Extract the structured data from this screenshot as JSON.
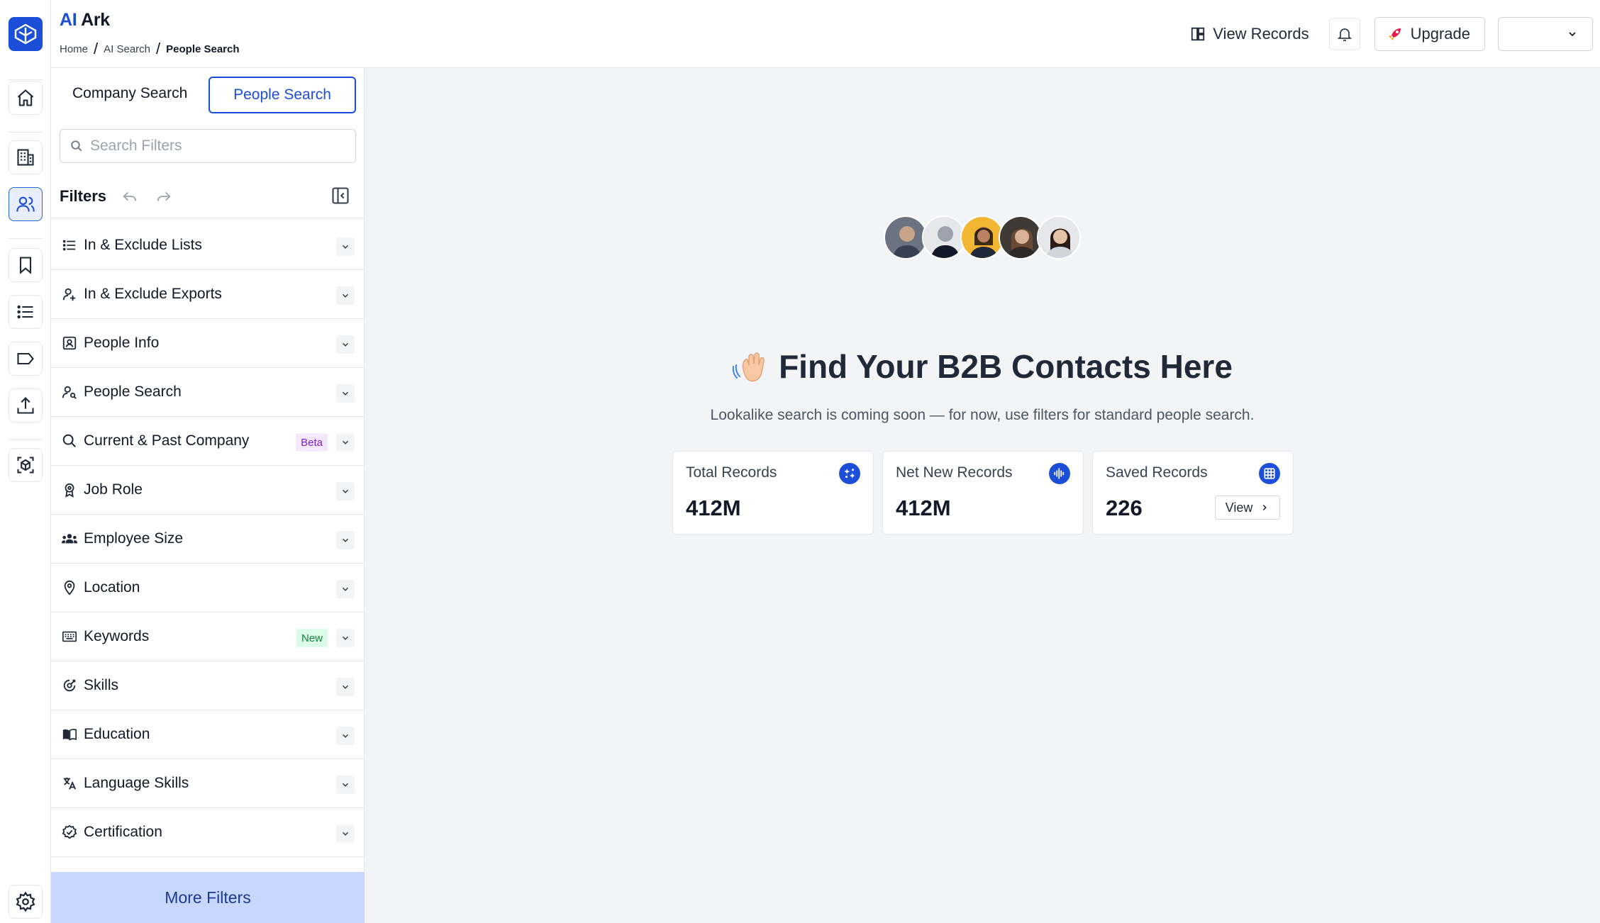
{
  "brand": {
    "ai": "AI",
    "ark": "Ark"
  },
  "breadcrumb": {
    "home": "Home",
    "ai_search": "AI Search",
    "current": "People Search"
  },
  "header": {
    "view_records": "View Records",
    "upgrade": "Upgrade"
  },
  "tabs": {
    "company": "Company Search",
    "people": "People Search"
  },
  "search": {
    "placeholder": "Search Filters"
  },
  "filters": {
    "title": "Filters",
    "items": [
      {
        "label": "In & Exclude Lists",
        "icon": "list-icon"
      },
      {
        "label": "In & Exclude Exports",
        "icon": "user-plus-icon"
      },
      {
        "label": "People Info",
        "icon": "id-card-icon"
      },
      {
        "label": "People Search",
        "icon": "user-search-icon"
      },
      {
        "label": "Current & Past Company",
        "icon": "search-icon",
        "badge": "Beta"
      },
      {
        "label": "Job Role",
        "icon": "badge-icon"
      },
      {
        "label": "Employee Size",
        "icon": "users-icon"
      },
      {
        "label": "Location",
        "icon": "map-pin-icon"
      },
      {
        "label": "Keywords",
        "icon": "keyboard-icon",
        "badge": "New"
      },
      {
        "label": "Skills",
        "icon": "skills-icon"
      },
      {
        "label": "Education",
        "icon": "book-icon"
      },
      {
        "label": "Language Skills",
        "icon": "translate-icon"
      },
      {
        "label": "Certification",
        "icon": "certificate-icon"
      }
    ],
    "more": "More Filters"
  },
  "main": {
    "headline": "Find Your B2B Contacts Here",
    "subline": "Lookalike search is coming soon — for now, use filters for standard people search.",
    "cards": [
      {
        "label": "Total Records",
        "value": "412M"
      },
      {
        "label": "Net New Records",
        "value": "412M"
      },
      {
        "label": "Saved Records",
        "value": "226",
        "button": "View"
      }
    ]
  },
  "colors": {
    "accent": "#1d4ed8",
    "more_filters_bg": "#c7d7fe",
    "beta_bg": "#f3e8ff",
    "new_bg": "#dcfce7"
  }
}
